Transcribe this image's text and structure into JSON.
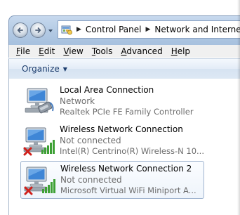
{
  "address_bar": {
    "icon": "control-panel-icon",
    "breadcrumbs": [
      "Control Panel",
      "Network and Internet"
    ]
  },
  "menu": {
    "items": [
      "File",
      "Edit",
      "View",
      "Tools",
      "Advanced",
      "Help"
    ],
    "underline_letters": [
      "F",
      "E",
      "V",
      "T",
      "A",
      "H"
    ]
  },
  "toolbar": {
    "organize_label": "Organize"
  },
  "connections": [
    {
      "name": "Local Area Connection",
      "status": "Network",
      "device": "Realtek PCIe FE Family Controller",
      "icon": "wired-network-icon",
      "selected": false
    },
    {
      "name": "Wireless Network Connection",
      "status": "Not connected",
      "device": "Intel(R) Centrino(R) Wireless-N 10...",
      "icon": "wireless-network-icon",
      "disconnected": true,
      "selected": false
    },
    {
      "name": "Wireless Network Connection 2",
      "status": "Not connected",
      "device": "Microsoft Virtual WiFi Miniport A...",
      "icon": "wireless-network-icon",
      "disconnected": true,
      "selected": true
    }
  ],
  "colors": {
    "accent": "#1e3e6e",
    "status_text": "#6d6d6d",
    "disconnected_x": "#d0201b",
    "signal_bars": "#3da034"
  }
}
